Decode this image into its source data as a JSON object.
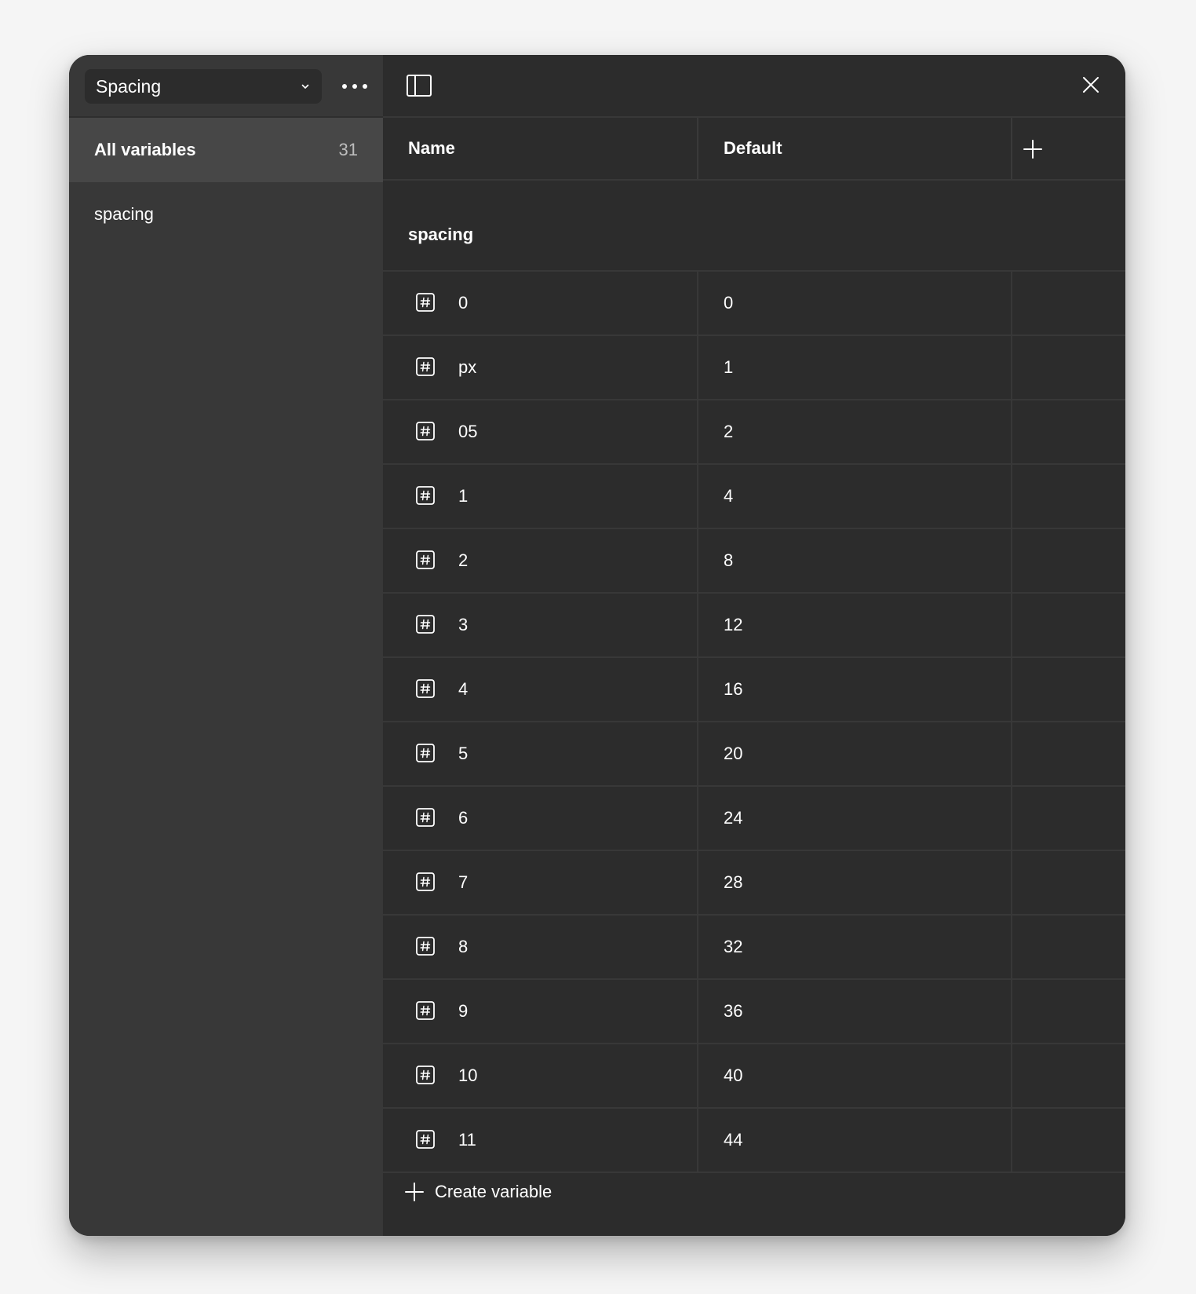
{
  "collection": {
    "selected": "Spacing"
  },
  "sidebar": {
    "groups": [
      {
        "label": "All variables",
        "count": "31"
      },
      {
        "label": "spacing"
      }
    ]
  },
  "table": {
    "columns": [
      "Name",
      "Default"
    ],
    "group_heading": "spacing",
    "rows": [
      {
        "name": "0",
        "value": "0"
      },
      {
        "name": "px",
        "value": "1"
      },
      {
        "name": "05",
        "value": "2"
      },
      {
        "name": "1",
        "value": "4"
      },
      {
        "name": "2",
        "value": "8"
      },
      {
        "name": "3",
        "value": "12"
      },
      {
        "name": "4",
        "value": "16"
      },
      {
        "name": "5",
        "value": "20"
      },
      {
        "name": "6",
        "value": "24"
      },
      {
        "name": "7",
        "value": "28"
      },
      {
        "name": "8",
        "value": "32"
      },
      {
        "name": "9",
        "value": "36"
      },
      {
        "name": "10",
        "value": "40"
      },
      {
        "name": "11",
        "value": "44"
      }
    ]
  },
  "footer": {
    "create_label": "Create variable"
  },
  "icons": {
    "collection_chevron": "chevron-down-icon",
    "more": "more-horizontal-icon",
    "panel": "sidebar-panel-icon",
    "close": "close-icon",
    "add_column": "plus-icon",
    "variable_type": "number-variable-icon",
    "create": "plus-icon"
  },
  "colors": {
    "window_bg": "#2c2c2c",
    "sidebar_bg": "#383838",
    "selected_group_bg": "#474747",
    "text": "#ffffff",
    "muted_text": "#bdbdbd"
  }
}
